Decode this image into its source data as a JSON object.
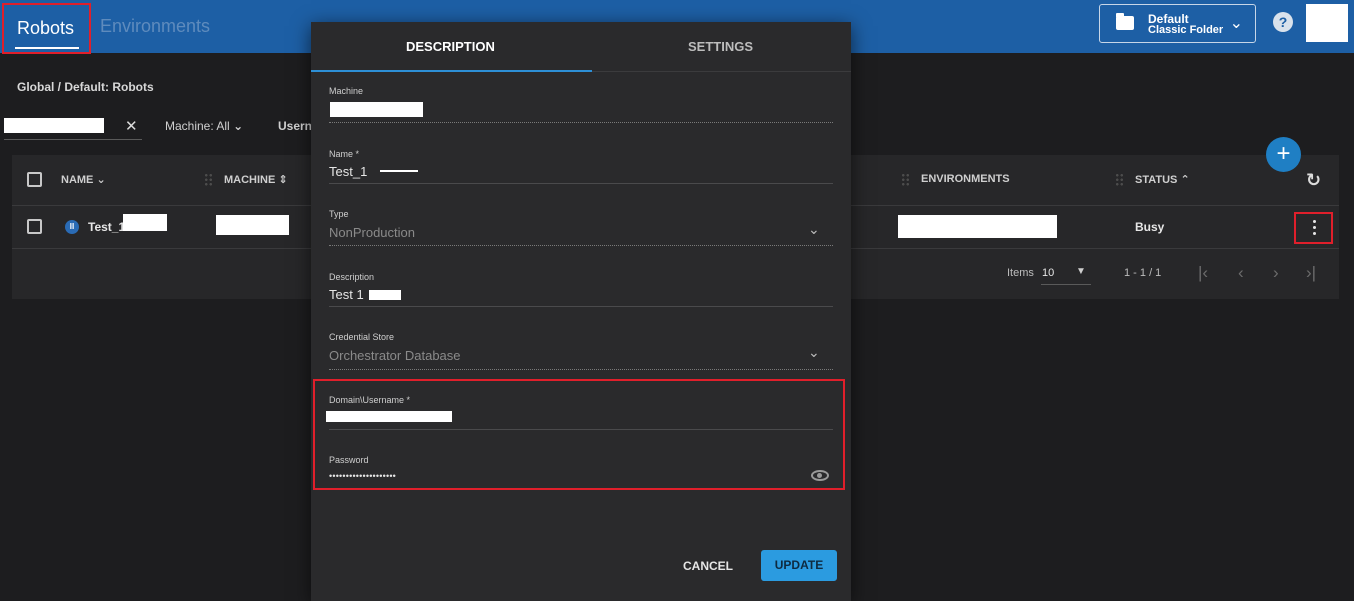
{
  "header": {
    "tab_robots": "Robots",
    "tab_environments": "Environments",
    "folder_name": "Default",
    "folder_type": "Classic Folder",
    "help_glyph": "?"
  },
  "page": {
    "breadcrumb": "Global / Default: Robots",
    "clear_glyph": "✕",
    "filter_machine_label": "Machine:",
    "filter_machine_value": "All",
    "filter_username_label": "Username"
  },
  "table": {
    "columns": {
      "name": "NAME",
      "machine": "MACHINE",
      "environments": "ENVIRONMENTS",
      "status": "STATUS"
    },
    "sort_glyphs": {
      "name": "⌄",
      "machine": "⇕",
      "status": "⌃"
    },
    "rows": [
      {
        "name": "Test_1",
        "status": "Busy",
        "icon_glyph": "II"
      }
    ],
    "pagination": {
      "items_label": "Items",
      "page_size": "10",
      "range": "1 - 1 / 1"
    },
    "add_glyph": "+",
    "refresh_glyph": "↻"
  },
  "dialog": {
    "tab_description": "DESCRIPTION",
    "tab_settings": "SETTINGS",
    "fields": {
      "machine_label": "Machine",
      "name_label": "Name *",
      "name_value": "Test_1",
      "type_label": "Type",
      "type_value": "NonProduction",
      "description_label": "Description",
      "description_value": "Test 1",
      "credential_store_label": "Credential Store",
      "credential_store_value": "Orchestrator Database",
      "domain_username_label": "Domain\\Username *",
      "password_label": "Password",
      "password_value": "••••••••••••••••••••"
    },
    "cancel_label": "CANCEL",
    "update_label": "UPDATE"
  },
  "icons": [
    "folder-icon",
    "chevron-down-icon",
    "help-icon",
    "close-icon",
    "robot-status-icon",
    "more-vert-icon",
    "add-icon",
    "refresh-icon",
    "eye-icon",
    "first-page-icon",
    "prev-page-icon",
    "next-page-icon",
    "last-page-icon"
  ],
  "colors": {
    "header": "#1d5fa5",
    "accent": "#2b9be0",
    "highlight": "#e01f2b",
    "background": "#1d1d1f"
  }
}
